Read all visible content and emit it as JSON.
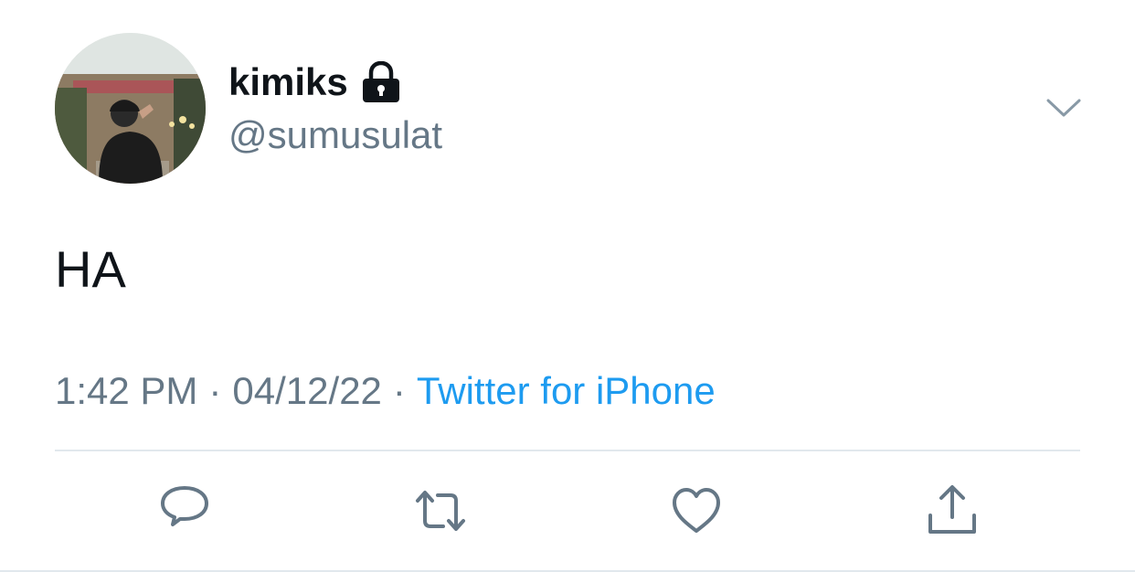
{
  "author": {
    "display_name": "kimiks",
    "handle": "@sumusulat",
    "protected_icon": "lock-icon",
    "avatar": "profile-photo"
  },
  "tweet": {
    "text": "HA",
    "time": "1:42 PM",
    "separator": "·",
    "date": "04/12/22",
    "source": "Twitter for iPhone"
  },
  "menu_icon": "chevron-down-icon",
  "actions": [
    {
      "icon": "reply-icon"
    },
    {
      "icon": "retweet-icon"
    },
    {
      "icon": "like-icon"
    },
    {
      "icon": "share-icon"
    }
  ],
  "colors": {
    "text_primary": "#0f1419",
    "text_secondary": "#657786",
    "link": "#1d9bf0",
    "divider": "#e1e8ed"
  }
}
